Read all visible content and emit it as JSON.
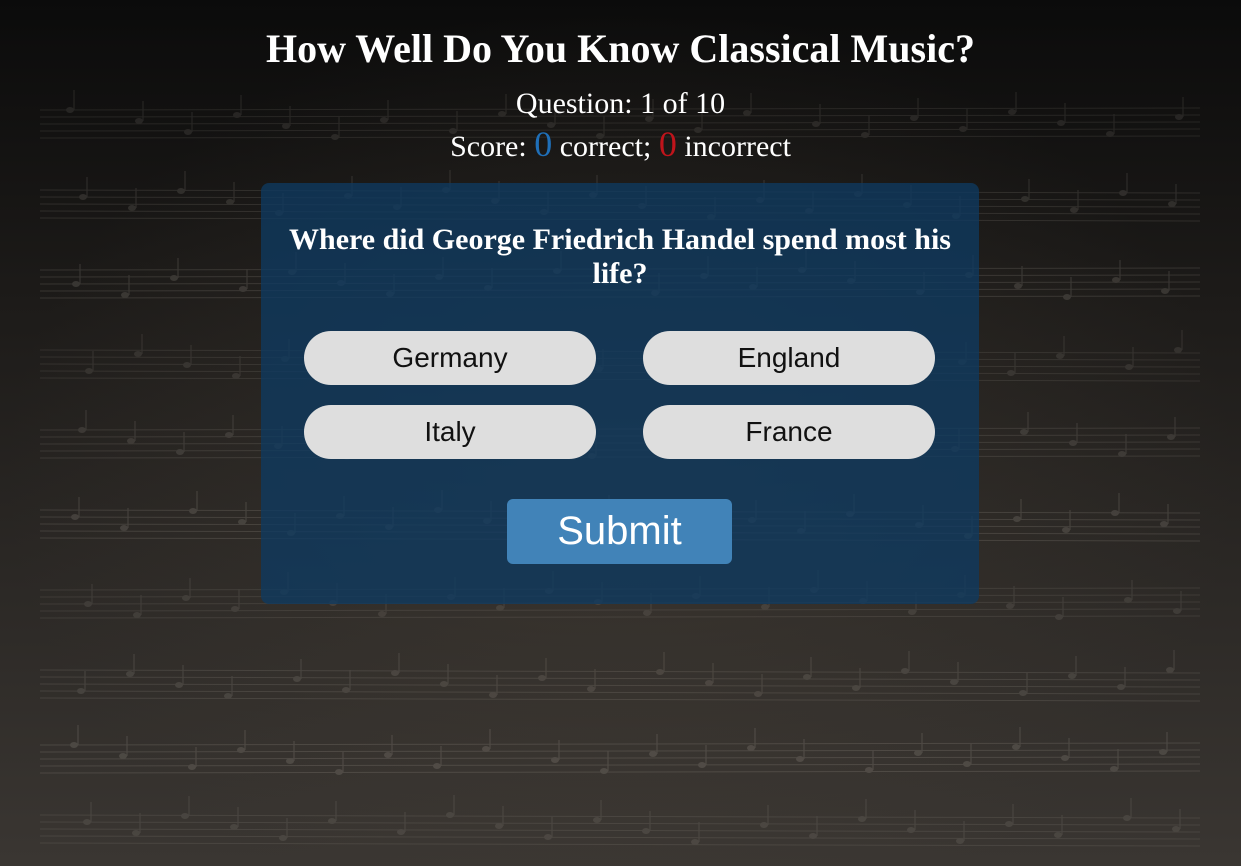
{
  "header": {
    "title": "How Well Do You Know Classical Music?",
    "question_prefix": "Question: ",
    "question_current": "1",
    "question_of": " of ",
    "question_total": "10",
    "score_prefix": "Score: ",
    "correct_count": "0",
    "correct_label": " correct; ",
    "incorrect_count": "0",
    "incorrect_label": " incorrect"
  },
  "quiz": {
    "question": "Where did George Friedrich Handel spend most his life?",
    "options": [
      "Germany",
      "England",
      "Italy",
      "France"
    ],
    "submit_label": "Submit"
  },
  "colors": {
    "correct": "#1f6fb8",
    "incorrect": "#c0141b",
    "card": "#0e3a60",
    "submit": "#4183b8",
    "option": "#dedede"
  },
  "icons": {
    "background": "sheet-music-background"
  }
}
